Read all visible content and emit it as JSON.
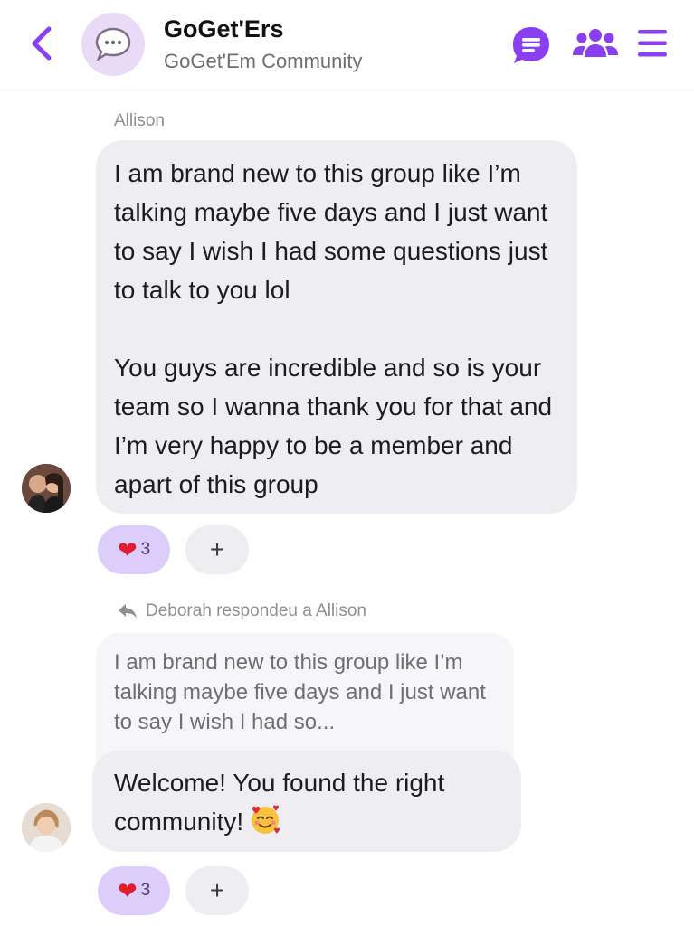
{
  "header": {
    "title": "GoGet'Ers",
    "subtitle": "GoGet'Em Community",
    "icons": [
      "back-chevron-icon",
      "chat-bubble-icon",
      "members-icon",
      "menu-icon"
    ],
    "accent_color": "#8a3ff0"
  },
  "messages": [
    {
      "sender": "Allison",
      "paragraphs": [
        "I am brand new to this group like I’m talking maybe five days and I just want to say I wish I had some questions just to talk to you lol",
        "You guys are incredible and so is your team so I wanna thank you for that and I’m very happy to be a member and apart of this group"
      ],
      "reaction": {
        "emoji": "❤",
        "count": "3"
      },
      "add_reaction": "+"
    },
    {
      "reply_context": "Deborah respondeu a Allison",
      "quoted": "I am brand new to this group like I’m talking maybe five days and I just want to say I wish I had so...",
      "text": "Welcome! You found the right community!",
      "emoji_icon": "smiling-face-with-hearts-icon",
      "reaction": {
        "emoji": "❤",
        "count": "3"
      },
      "add_reaction": "+"
    }
  ]
}
